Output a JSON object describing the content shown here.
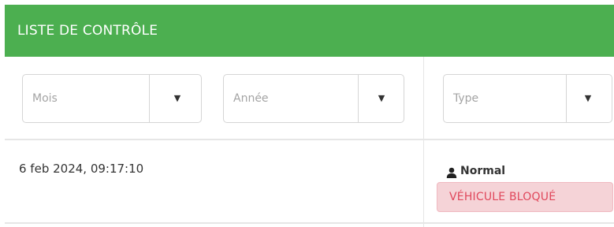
{
  "header": {
    "title": "LISTE DE CONTRÔLE"
  },
  "filters": {
    "month": {
      "placeholder": "Mois"
    },
    "year": {
      "placeholder": "Année"
    },
    "type": {
      "placeholder": "Type"
    },
    "arrow_icon": "chevron-down-icon"
  },
  "row": {
    "date": "6 feb 2024, 09:17:10",
    "user_icon": "user-icon",
    "user_label": "Normal",
    "status": "VÉHICULE BLOQUÉ"
  },
  "colors": {
    "header_bg": "#4caf50",
    "status_bg": "#f5d3d7",
    "status_text": "#e0475b"
  }
}
